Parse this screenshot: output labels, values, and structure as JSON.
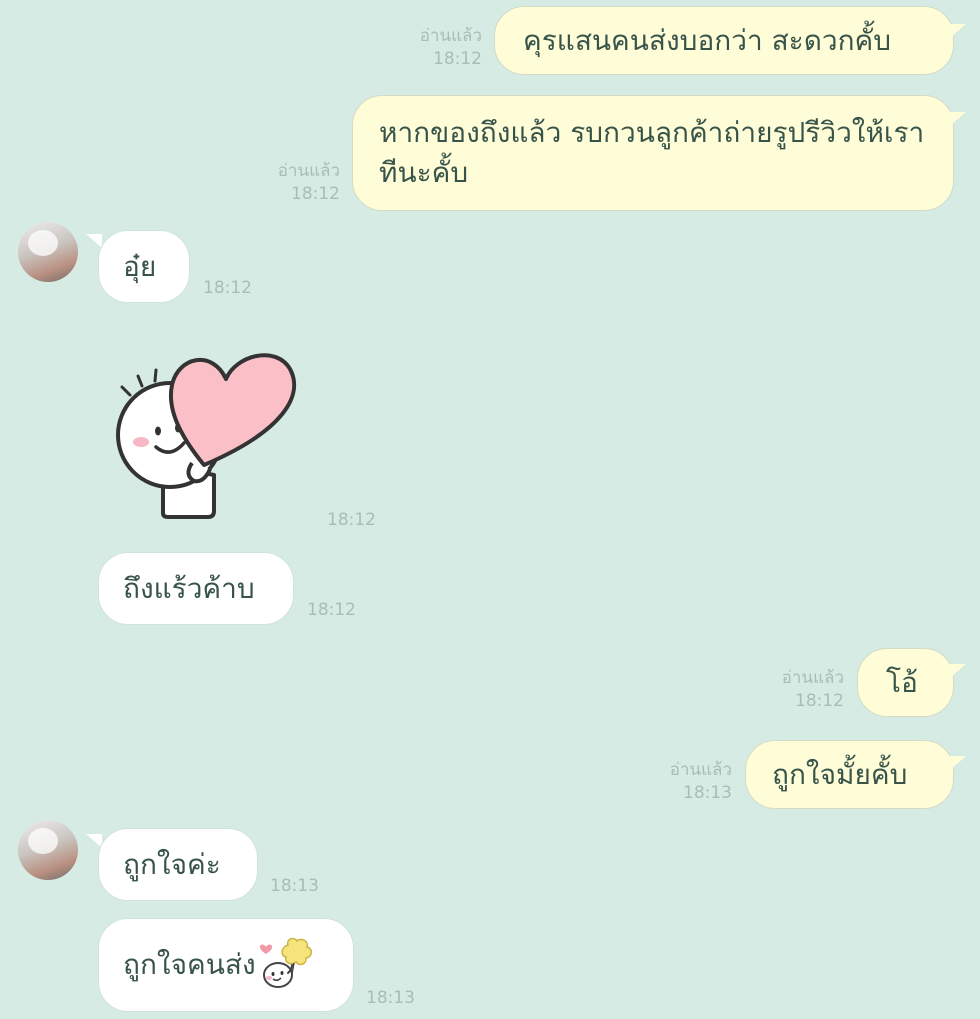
{
  "messages": [
    {
      "text": "คุรแสนคนส่งบอกว่า สะดวกคั้บ",
      "read": "อ่านแล้ว",
      "time": "18:12"
    },
    {
      "text": "หากของถึงแล้ว รบกวนลูกค้าถ่ายรูปรีวิวให้เราทีนะคั้บ",
      "read": "อ่านแล้ว",
      "time": "18:12"
    },
    {
      "text": "อุ๋ย",
      "time": "18:12"
    },
    {
      "sticker": "heart-hug-sticker",
      "time": "18:12"
    },
    {
      "text": "ถึงแร้วค้าบ",
      "time": "18:12"
    },
    {
      "text": "โอ้",
      "read": "อ่านแล้ว",
      "time": "18:12"
    },
    {
      "text": "ถูกใจมั้ยคั้บ",
      "read": "อ่านแล้ว",
      "time": "18:13"
    },
    {
      "text": "ถูกใจค่ะ",
      "time": "18:13"
    },
    {
      "text": "ถูกใจคนส่ง",
      "emoji": "cheer-emoji",
      "time": "18:13"
    }
  ]
}
